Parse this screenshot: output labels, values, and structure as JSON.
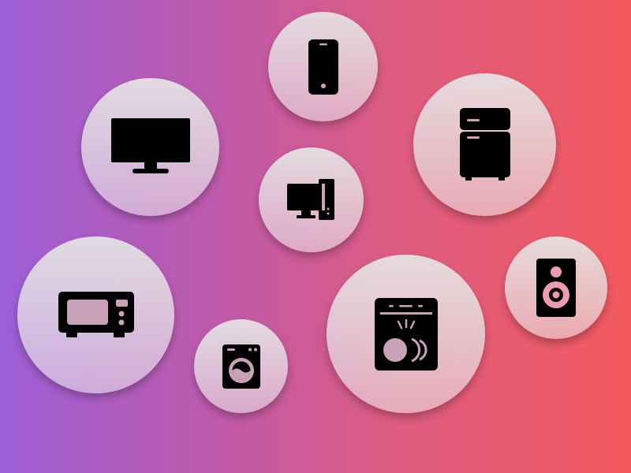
{
  "background": {
    "gradient_start": "#9d5fd7",
    "gradient_end": "#f25a5d"
  },
  "icon_color": "#000000",
  "bubbles": [
    {
      "icon": "smartphone-icon"
    },
    {
      "icon": "television-icon"
    },
    {
      "icon": "refrigerator-icon"
    },
    {
      "icon": "desktop-computer-icon"
    },
    {
      "icon": "microwave-icon"
    },
    {
      "icon": "washing-machine-icon"
    },
    {
      "icon": "dishwasher-icon"
    },
    {
      "icon": "speaker-icon"
    }
  ]
}
